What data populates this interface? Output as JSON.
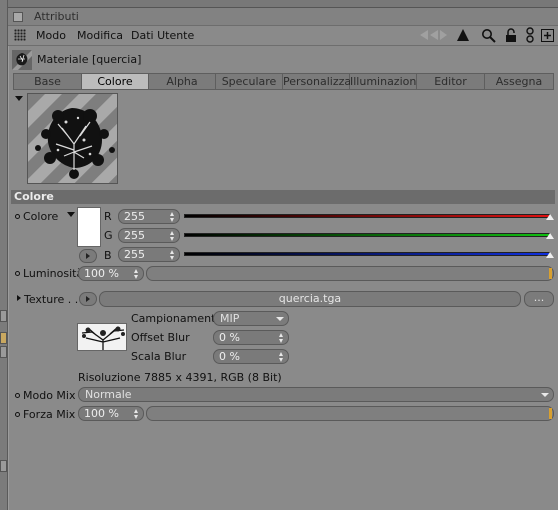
{
  "panel": {
    "title": "Attributi",
    "menu": [
      "Modo",
      "Modifica",
      "Dati Utente"
    ],
    "toolbar_icons": [
      "back-arrows-icon",
      "cursor-arrow-icon",
      "search-icon",
      "lock-icon",
      "link-icon",
      "add-panel-icon"
    ]
  },
  "material": {
    "name": "Materiale [quercia]"
  },
  "tabs": [
    {
      "label": "Base",
      "active": false
    },
    {
      "label": "Colore",
      "active": true
    },
    {
      "label": "Alpha",
      "active": false
    },
    {
      "label": "Speculare",
      "active": false
    },
    {
      "label": "Personalizza",
      "active": false
    },
    {
      "label": "Illuminazione",
      "active": false
    },
    {
      "label": "Editor",
      "active": false
    },
    {
      "label": "Assegna",
      "active": false
    }
  ],
  "section": {
    "header": "Colore"
  },
  "color": {
    "label": "Colore",
    "swatch": "#ffffff",
    "channels": [
      {
        "name": "R",
        "value": "255",
        "color": "#e01010"
      },
      {
        "name": "G",
        "value": "255",
        "color": "#10c010"
      },
      {
        "name": "B",
        "value": "255",
        "color": "#1030e0"
      }
    ]
  },
  "luminosita": {
    "label": "Luminosità",
    "value": "100 %"
  },
  "texture": {
    "label": "Texture . . .",
    "filename": "quercia.tga",
    "more_button": "...",
    "campionamento_label": "Campionamento",
    "campionamento_value": "MIP",
    "offset_blur_label": "Offset Blur",
    "offset_blur_value": "0 %",
    "scala_blur_label": "Scala Blur",
    "scala_blur_value": "0 %",
    "resolution": "Risoluzione 7885 x 4391, RGB (8 Bit)"
  },
  "modo_mix": {
    "label": "Modo Mix",
    "value": "Normale"
  },
  "forza_mix": {
    "label": "Forza Mix",
    "value": "100 %"
  }
}
